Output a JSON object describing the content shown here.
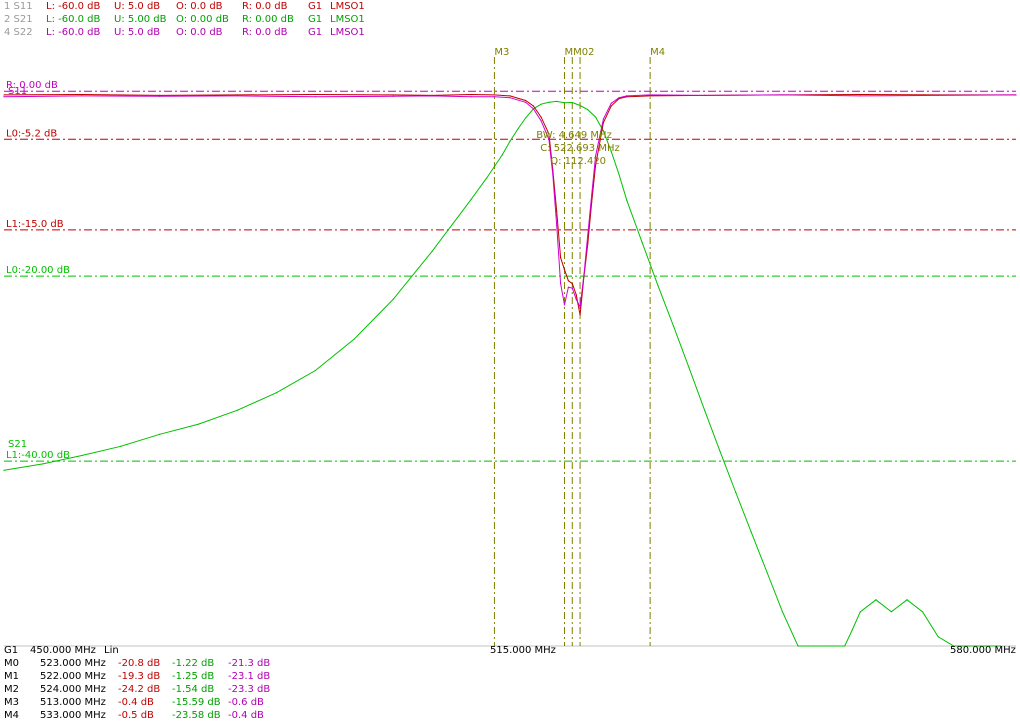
{
  "header": {
    "rows": [
      {
        "id": "1 S11",
        "lower": "L: -60.0 dB",
        "upper": "U:  5.0 dB",
        "offset": "O:  0.0 dB",
        "ref": "R:  0.0 dB",
        "group": "G1",
        "name": "LMSO1",
        "color": "#c00000"
      },
      {
        "id": "2 S21",
        "lower": "L: -60.0 dB",
        "upper": "U:  5.00 dB",
        "offset": "O:  0.00 dB",
        "ref": "R:  0.00 dB",
        "group": "G1",
        "name": "LMSO1",
        "color": "#00a000"
      },
      {
        "id": "4 S22",
        "lower": "L: -60.0 dB",
        "upper": "U:  5.0 dB",
        "offset": "O:  0.0 dB",
        "ref": "R:  0.0 dB",
        "group": "G1",
        "name": "LMSO1",
        "color": "#b000b0"
      }
    ]
  },
  "footer": {
    "group": "G1",
    "start": "450.000 MHz",
    "scale": "Lin",
    "mid_label": "515.000 MHz",
    "stop": "580.000 MHz"
  },
  "marker_table": [
    {
      "name": "M0",
      "freq": "523.000 MHz",
      "s11": "-20.8 dB",
      "s21": "-1.22 dB",
      "s22": "-21.3 dB"
    },
    {
      "name": "M1",
      "freq": "522.000 MHz",
      "s11": "-19.3 dB",
      "s21": "-1.25 dB",
      "s22": "-23.1 dB"
    },
    {
      "name": "M2",
      "freq": "524.000 MHz",
      "s11": "-24.2 dB",
      "s21": "-1.54 dB",
      "s22": "-23.3 dB"
    },
    {
      "name": "M3",
      "freq": "513.000 MHz",
      "s11": "-0.4 dB",
      "s21": "-15.59 dB",
      "s22": "-0.6 dB"
    },
    {
      "name": "M4",
      "freq": "533.000 MHz",
      "s11": "-0.5 dB",
      "s21": "-23.58 dB",
      "s22": "-0.4 dB"
    }
  ],
  "chart_data": {
    "type": "line",
    "x_unit": "MHz",
    "xlim": [
      450,
      580
    ],
    "ylim": [
      -60,
      5
    ],
    "x_tick_labels": [
      "515.000 MHz",
      "580.000 MHz"
    ],
    "colors": {
      "S11": "#c00000",
      "S21": "#00c000",
      "S22": "#d000d0",
      "marker": "#808000"
    },
    "series": [
      {
        "name": "S21",
        "color": "#00c000",
        "x": [
          450,
          455,
          460,
          465,
          470,
          475,
          480,
          485,
          490,
          495,
          500,
          505,
          510,
          512,
          514,
          515,
          516,
          517,
          518,
          519,
          520,
          521,
          522,
          523,
          524,
          525,
          526,
          527,
          528,
          529,
          530,
          532,
          534,
          536,
          538,
          540,
          542,
          544,
          546,
          548,
          550,
          552,
          554,
          556,
          558,
          559,
          560,
          562,
          564,
          566,
          568,
          570,
          572,
          574,
          576,
          578
        ],
        "y": [
          -41.0,
          -40.3,
          -39.4,
          -38.4,
          -37.1,
          -36.0,
          -34.5,
          -32.6,
          -30.2,
          -26.8,
          -22.5,
          -17.3,
          -11.7,
          -9.4,
          -6.9,
          -5.4,
          -4.1,
          -2.9,
          -1.9,
          -1.4,
          -1.2,
          -1.1,
          -1.25,
          -1.22,
          -1.54,
          -2.0,
          -2.8,
          -4.3,
          -6.5,
          -9.0,
          -11.8,
          -16.4,
          -21.0,
          -25.4,
          -29.9,
          -34.5,
          -39.0,
          -43.4,
          -47.7,
          -52.0,
          -56.3,
          -60.0,
          -60.0,
          -60.0,
          -60.0,
          -58.2,
          -56.3,
          -55.0,
          -56.3,
          -55.0,
          -56.3,
          -59.0,
          -60.0,
          -60.0,
          -60.0,
          -60.0
        ]
      },
      {
        "name": "S11",
        "color": "#c00000",
        "x": [
          450,
          460,
          470,
          480,
          490,
          500,
          505,
          510,
          513,
          515,
          517,
          518,
          519,
          520,
          520.5,
          521,
          521.5,
          522,
          522.5,
          523,
          523.5,
          524,
          524.5,
          525,
          525.5,
          526,
          527,
          528,
          529,
          530,
          533,
          540,
          550,
          560,
          570,
          580
        ],
        "y": [
          -0.4,
          -0.35,
          -0.45,
          -0.4,
          -0.35,
          -0.4,
          -0.45,
          -0.35,
          -0.4,
          -0.5,
          -1.0,
          -1.6,
          -2.8,
          -4.6,
          -8.5,
          -13.0,
          -18.0,
          -19.3,
          -20.5,
          -20.8,
          -22.0,
          -24.2,
          -20.0,
          -16.5,
          -12.0,
          -8.0,
          -3.4,
          -1.6,
          -0.8,
          -0.6,
          -0.5,
          -0.45,
          -0.4,
          -0.35,
          -0.4,
          -0.4
        ]
      },
      {
        "name": "S22",
        "color": "#d000d0",
        "x": [
          450,
          460,
          470,
          480,
          490,
          500,
          505,
          510,
          513,
          515,
          517,
          518,
          519,
          520,
          520.5,
          521,
          521.5,
          522,
          522.5,
          523,
          523.5,
          524,
          524.5,
          525,
          525.5,
          526,
          527,
          528,
          529,
          530,
          533,
          540,
          550,
          560,
          570,
          580
        ],
        "y": [
          -0.6,
          -0.5,
          -0.55,
          -0.5,
          -0.6,
          -0.55,
          -0.5,
          -0.6,
          -0.6,
          -0.7,
          -1.2,
          -1.9,
          -3.2,
          -5.2,
          -9.0,
          -14.5,
          -20.8,
          -23.1,
          -21.2,
          -21.3,
          -22.5,
          -23.3,
          -19.8,
          -15.5,
          -11.2,
          -7.0,
          -3.0,
          -1.3,
          -0.7,
          -0.5,
          -0.4,
          -0.45,
          -0.4,
          -0.5,
          -0.45,
          -0.4
        ]
      }
    ],
    "limit_lines": [
      {
        "label": "R: 0.00 dB",
        "value": 0,
        "color": "#c000c0",
        "style": "dashdot"
      },
      {
        "label": "L0:-5.2 dB",
        "value": -5.2,
        "color": "#c00000",
        "style": "dashdot"
      },
      {
        "label": "L1:-15.0 dB",
        "value": -15,
        "color": "#c00000",
        "style": "dashdot"
      },
      {
        "label": "L0:-20.00 dB",
        "value": -20,
        "color": "#00c000",
        "style": "dashdot"
      },
      {
        "label": "L1:-40.00 dB",
        "value": -40,
        "color": "#00c000",
        "style": "dashdot"
      }
    ],
    "trace_labels": [
      {
        "label": "S11",
        "at_value": -0.4,
        "color": "#c000c0"
      },
      {
        "label": "S21",
        "at_value": -38.6,
        "color": "#00c000"
      }
    ],
    "markers": [
      {
        "name": "M3",
        "x": 513,
        "label_shown": true
      },
      {
        "name": "M1",
        "x": 522,
        "label_shown": false
      },
      {
        "name": "M0",
        "x": 523,
        "label_shown": false
      },
      {
        "name": "M2",
        "x": 524,
        "label_shown": false
      },
      {
        "name": "M4",
        "x": 533,
        "label_shown": true
      }
    ],
    "marker_cluster_label": "MM02",
    "bandwidth": {
      "bw": "BW:  4.649 MHz",
      "center": "C: 522.693 MHz",
      "q": "Q: 112.420"
    }
  }
}
